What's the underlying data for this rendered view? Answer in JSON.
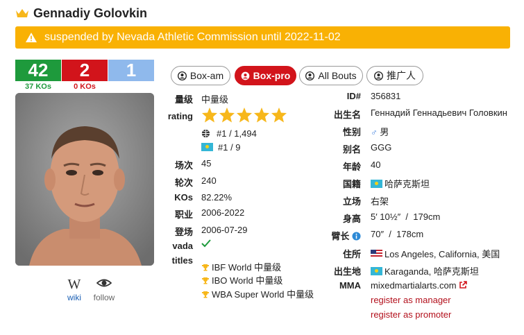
{
  "boxer": {
    "name": "Gennadiy Golovkin"
  },
  "banner": {
    "text": "suspended by Nevada Athletic Commission until 2022-11-02"
  },
  "record": {
    "wins": "42",
    "losses": "2",
    "draws": "1",
    "wins_kos": "37 KOs",
    "losses_kos": "0 KOs"
  },
  "links": {
    "wiki": "wiki",
    "follow": "follow"
  },
  "tabs": [
    {
      "label": "Box-am",
      "active": false
    },
    {
      "label": "Box-pro",
      "active": true
    },
    {
      "label": "All Bouts",
      "active": false
    },
    {
      "label": "推广人",
      "active": false
    }
  ],
  "stats": {
    "division_label": "量级",
    "division": "中量级",
    "rating_label": "rating",
    "rating_stars": 5,
    "rank_world": "#1 / 1,494",
    "rank_country": "#1 / 9",
    "bouts_label": "场次",
    "bouts": "45",
    "rounds_label": "轮次",
    "rounds": "240",
    "kos_label": "KOs",
    "kos": "82.22%",
    "career_label": "职业",
    "career": "2006-2022",
    "debut_label": "登场",
    "debut": "2006-07-29",
    "vada_label": "vada",
    "titles_label": "titles",
    "titles": [
      "IBF World 中量级",
      "IBO World 中量级",
      "WBA Super World 中量级"
    ]
  },
  "bio": {
    "id_label": "ID#",
    "id": "356831",
    "birthname_label": "出生名",
    "birthname": "Геннадий Геннадьевич Головкин",
    "sex_label": "性别",
    "sex": "男",
    "alias_label": "别名",
    "alias": "GGG",
    "age_label": "年龄",
    "age": "40",
    "nationality_label": "国籍",
    "nationality": "哈萨克斯坦",
    "stance_label": "立场",
    "stance": "右架",
    "height_label": "身高",
    "height_imperial": "5′ 10½″",
    "height_sep": "/",
    "height_metric": "179cm",
    "reach_label": "臂长",
    "reach_imperial": "70″",
    "reach_sep": "/",
    "reach_metric": "178cm",
    "residence_label": "住所",
    "residence": "Los Angeles, California, 美国",
    "birthplace_label": "出生地",
    "birthplace": "Karaganda, 哈萨克斯坦",
    "mma_label": "MMA",
    "mma": "mixedmartialarts.com",
    "register_manager": "register as manager",
    "register_promoter": "register as promoter"
  },
  "colors": {
    "win": "#1e9a3c",
    "loss": "#d2141b",
    "draw": "#8fb9ec",
    "banner": "#f9b104",
    "star": "#f7b71b"
  }
}
